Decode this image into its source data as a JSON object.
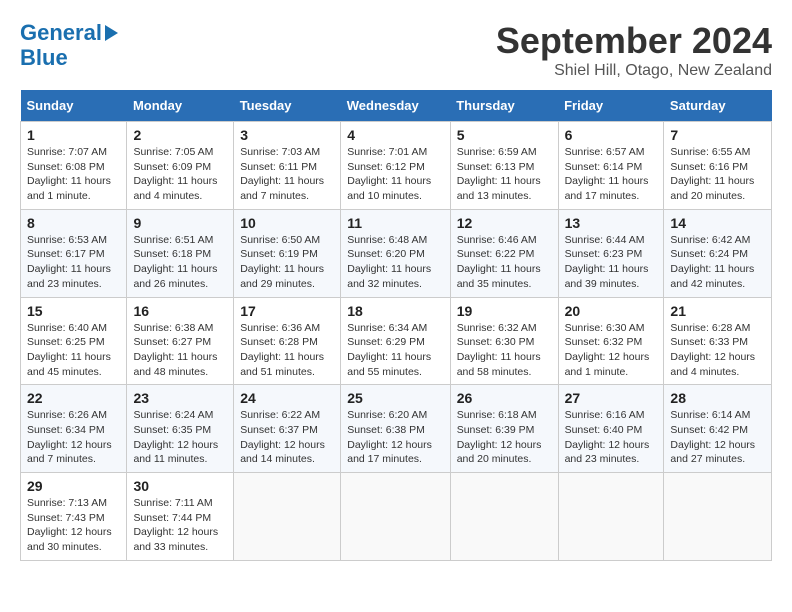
{
  "header": {
    "logo_line1": "General",
    "logo_line2": "Blue",
    "month": "September 2024",
    "location": "Shiel Hill, Otago, New Zealand"
  },
  "weekdays": [
    "Sunday",
    "Monday",
    "Tuesday",
    "Wednesday",
    "Thursday",
    "Friday",
    "Saturday"
  ],
  "weeks": [
    [
      {
        "day": "1",
        "info": "Sunrise: 7:07 AM\nSunset: 6:08 PM\nDaylight: 11 hours\nand 1 minute."
      },
      {
        "day": "2",
        "info": "Sunrise: 7:05 AM\nSunset: 6:09 PM\nDaylight: 11 hours\nand 4 minutes."
      },
      {
        "day": "3",
        "info": "Sunrise: 7:03 AM\nSunset: 6:11 PM\nDaylight: 11 hours\nand 7 minutes."
      },
      {
        "day": "4",
        "info": "Sunrise: 7:01 AM\nSunset: 6:12 PM\nDaylight: 11 hours\nand 10 minutes."
      },
      {
        "day": "5",
        "info": "Sunrise: 6:59 AM\nSunset: 6:13 PM\nDaylight: 11 hours\nand 13 minutes."
      },
      {
        "day": "6",
        "info": "Sunrise: 6:57 AM\nSunset: 6:14 PM\nDaylight: 11 hours\nand 17 minutes."
      },
      {
        "day": "7",
        "info": "Sunrise: 6:55 AM\nSunset: 6:16 PM\nDaylight: 11 hours\nand 20 minutes."
      }
    ],
    [
      {
        "day": "8",
        "info": "Sunrise: 6:53 AM\nSunset: 6:17 PM\nDaylight: 11 hours\nand 23 minutes."
      },
      {
        "day": "9",
        "info": "Sunrise: 6:51 AM\nSunset: 6:18 PM\nDaylight: 11 hours\nand 26 minutes."
      },
      {
        "day": "10",
        "info": "Sunrise: 6:50 AM\nSunset: 6:19 PM\nDaylight: 11 hours\nand 29 minutes."
      },
      {
        "day": "11",
        "info": "Sunrise: 6:48 AM\nSunset: 6:20 PM\nDaylight: 11 hours\nand 32 minutes."
      },
      {
        "day": "12",
        "info": "Sunrise: 6:46 AM\nSunset: 6:22 PM\nDaylight: 11 hours\nand 35 minutes."
      },
      {
        "day": "13",
        "info": "Sunrise: 6:44 AM\nSunset: 6:23 PM\nDaylight: 11 hours\nand 39 minutes."
      },
      {
        "day": "14",
        "info": "Sunrise: 6:42 AM\nSunset: 6:24 PM\nDaylight: 11 hours\nand 42 minutes."
      }
    ],
    [
      {
        "day": "15",
        "info": "Sunrise: 6:40 AM\nSunset: 6:25 PM\nDaylight: 11 hours\nand 45 minutes."
      },
      {
        "day": "16",
        "info": "Sunrise: 6:38 AM\nSunset: 6:27 PM\nDaylight: 11 hours\nand 48 minutes."
      },
      {
        "day": "17",
        "info": "Sunrise: 6:36 AM\nSunset: 6:28 PM\nDaylight: 11 hours\nand 51 minutes."
      },
      {
        "day": "18",
        "info": "Sunrise: 6:34 AM\nSunset: 6:29 PM\nDaylight: 11 hours\nand 55 minutes."
      },
      {
        "day": "19",
        "info": "Sunrise: 6:32 AM\nSunset: 6:30 PM\nDaylight: 11 hours\nand 58 minutes."
      },
      {
        "day": "20",
        "info": "Sunrise: 6:30 AM\nSunset: 6:32 PM\nDaylight: 12 hours\nand 1 minute."
      },
      {
        "day": "21",
        "info": "Sunrise: 6:28 AM\nSunset: 6:33 PM\nDaylight: 12 hours\nand 4 minutes."
      }
    ],
    [
      {
        "day": "22",
        "info": "Sunrise: 6:26 AM\nSunset: 6:34 PM\nDaylight: 12 hours\nand 7 minutes."
      },
      {
        "day": "23",
        "info": "Sunrise: 6:24 AM\nSunset: 6:35 PM\nDaylight: 12 hours\nand 11 minutes."
      },
      {
        "day": "24",
        "info": "Sunrise: 6:22 AM\nSunset: 6:37 PM\nDaylight: 12 hours\nand 14 minutes."
      },
      {
        "day": "25",
        "info": "Sunrise: 6:20 AM\nSunset: 6:38 PM\nDaylight: 12 hours\nand 17 minutes."
      },
      {
        "day": "26",
        "info": "Sunrise: 6:18 AM\nSunset: 6:39 PM\nDaylight: 12 hours\nand 20 minutes."
      },
      {
        "day": "27",
        "info": "Sunrise: 6:16 AM\nSunset: 6:40 PM\nDaylight: 12 hours\nand 23 minutes."
      },
      {
        "day": "28",
        "info": "Sunrise: 6:14 AM\nSunset: 6:42 PM\nDaylight: 12 hours\nand 27 minutes."
      }
    ],
    [
      {
        "day": "29",
        "info": "Sunrise: 7:13 AM\nSunset: 7:43 PM\nDaylight: 12 hours\nand 30 minutes."
      },
      {
        "day": "30",
        "info": "Sunrise: 7:11 AM\nSunset: 7:44 PM\nDaylight: 12 hours\nand 33 minutes."
      },
      {
        "day": "",
        "info": ""
      },
      {
        "day": "",
        "info": ""
      },
      {
        "day": "",
        "info": ""
      },
      {
        "day": "",
        "info": ""
      },
      {
        "day": "",
        "info": ""
      }
    ]
  ]
}
